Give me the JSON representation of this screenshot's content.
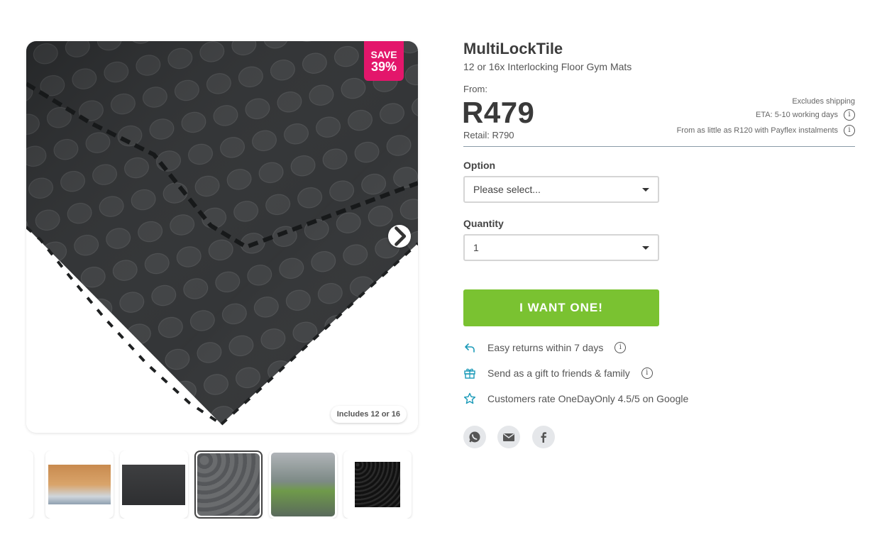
{
  "product": {
    "title": "MultiLockTile",
    "subtitle": "12 or 16x Interlocking Floor Gym Mats",
    "from_label": "From:",
    "price": "R479",
    "retail": "Retail: R790",
    "save_line1": "SAVE",
    "save_line2": "39%",
    "includes_badge": "Includes 12 or 16"
  },
  "shipping": {
    "excludes": "Excludes shipping",
    "eta": "ETA: 5-10 working days",
    "payflex": "From as little as R120 with Payflex instalments"
  },
  "options": {
    "option_label": "Option",
    "option_value": "Please select...",
    "quantity_label": "Quantity",
    "quantity_value": "1"
  },
  "cta": {
    "label": "I WANT ONE!"
  },
  "features": [
    {
      "text": "Easy returns within 7 days",
      "icon": "return-arrow-icon"
    },
    {
      "text": "Send as a gift to friends & family",
      "icon": "gift-icon"
    },
    {
      "text": "Customers rate OneDayOnly 4.5/5 on Google",
      "icon": "star-icon"
    }
  ],
  "share": [
    "whatsapp-icon",
    "email-icon",
    "facebook-icon"
  ],
  "colors": {
    "accent_green": "#7ac231",
    "save_pink": "#e3166b",
    "feature_icon": "#1a9ab8"
  }
}
